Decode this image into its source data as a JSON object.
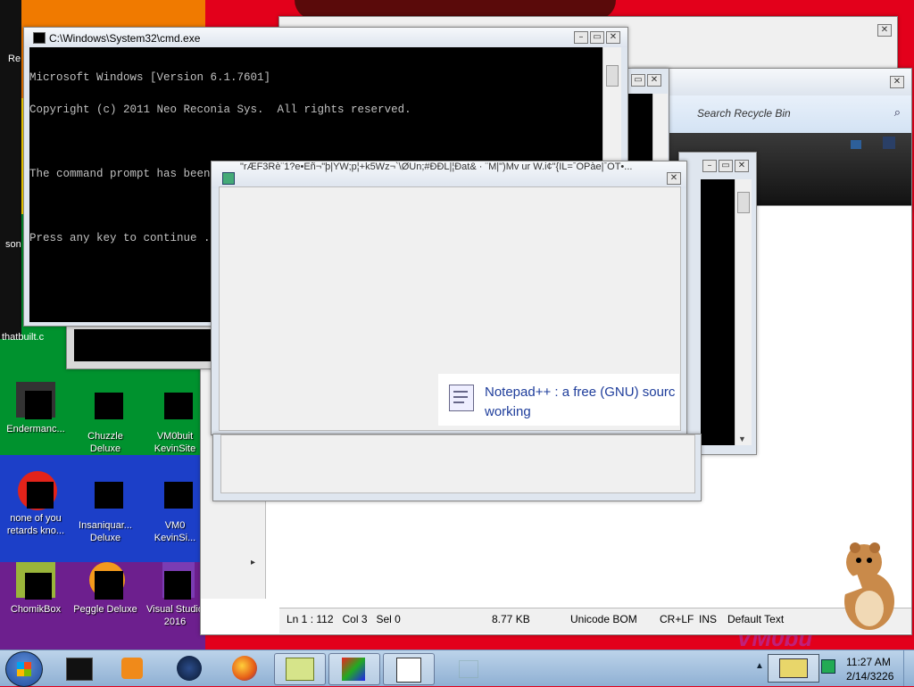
{
  "desktop": {
    "partial_labels": {
      "re": "Re",
      "son": "son",
      "thatbuilt": "thatbuilt.c"
    },
    "icons": [
      {
        "label": "Endermanc..."
      },
      {
        "label": "Chuzzle Deluxe"
      },
      {
        "label": "VM0buit KevinSite"
      },
      {
        "label": "none of you retards kno..."
      },
      {
        "label": "Insaniquar... Deluxe"
      },
      {
        "label": "VM0 KevinSi..."
      },
      {
        "label": "ChomikBox"
      },
      {
        "label": "Peggle Deluxe"
      },
      {
        "label": "Visual Studio 2016"
      }
    ],
    "wallpaper_text": "VM0bu"
  },
  "cmd": {
    "title": "C:\\Windows\\System32\\cmd.exe",
    "lines": [
      "Microsoft Windows [Version 6.1.7601]",
      "Copyright (c) 2011 Neo Reconia Sys.  All rights reserved.",
      "",
      "The command prompt has been disabled by your administrator.",
      "",
      "Press any key to continue . . ."
    ]
  },
  "garbled_window": {
    "title": "\"rÆF3Rè¨1?e•Eñ¬\"þ|YW;p¦+k5Wz¬`\\ØUn;#ÐÐL|¦Ðat& · ¨M|\")Mv ur W.i¢\"{IL=ˉOPàe|ˉOT•..."
  },
  "notification": {
    "line1": "Notepad++ : a free (GNU) sourc",
    "line2": "working"
  },
  "recycle_bin": {
    "search_placeholder": "Search Recycle Bin"
  },
  "notepad_status": {
    "position": "Ln 1 : 112   Col 3   Sel 0",
    "size": "8.77 KB",
    "encoding": "Unicode BOM",
    "eol": "CR+LF",
    "mode": "INS",
    "lang": "Default Text"
  },
  "taskbar": {
    "time": "11:27 AM",
    "date": "2/14/3226"
  },
  "colors": {
    "taskbar": "#9fbde0",
    "desktop_red": "#e3001b",
    "console_bg": "#000000"
  }
}
